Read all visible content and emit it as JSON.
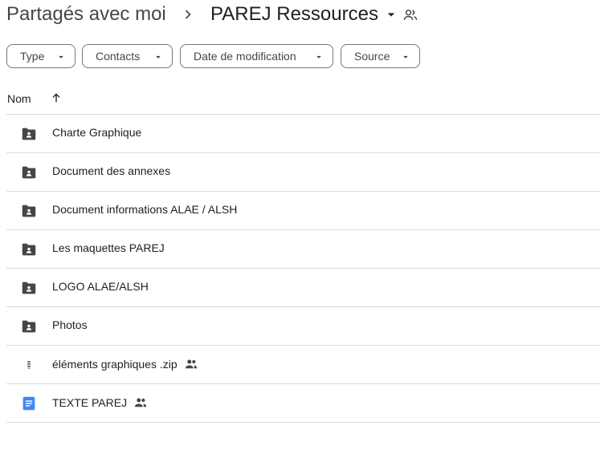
{
  "breadcrumb": {
    "root": "Partagés avec moi",
    "current": "PAREJ Ressources"
  },
  "filters": {
    "type": "Type",
    "contacts": "Contacts",
    "date": "Date de modification",
    "source": "Source"
  },
  "list_header": {
    "name": "Nom"
  },
  "files": [
    {
      "name": "Charte Graphique",
      "icon": "shared-folder-icon",
      "shared": false
    },
    {
      "name": "Document des annexes",
      "icon": "shared-folder-icon",
      "shared": false
    },
    {
      "name": "Document informations ALAE / ALSH",
      "icon": "shared-folder-icon",
      "shared": false
    },
    {
      "name": "Les maquettes PAREJ",
      "icon": "shared-folder-icon",
      "shared": false
    },
    {
      "name": "LOGO ALAE/ALSH",
      "icon": "shared-folder-icon",
      "shared": false
    },
    {
      "name": "Photos",
      "icon": "shared-folder-icon",
      "shared": false
    },
    {
      "name": "éléments graphiques .zip",
      "icon": "zip-file-icon",
      "shared": true
    },
    {
      "name": "TEXTE PAREJ",
      "icon": "google-docs-icon",
      "shared": true
    }
  ],
  "colors": {
    "docs_blue": "#4285f4",
    "icon_gray": "#444746",
    "divider": "#dadce0"
  }
}
